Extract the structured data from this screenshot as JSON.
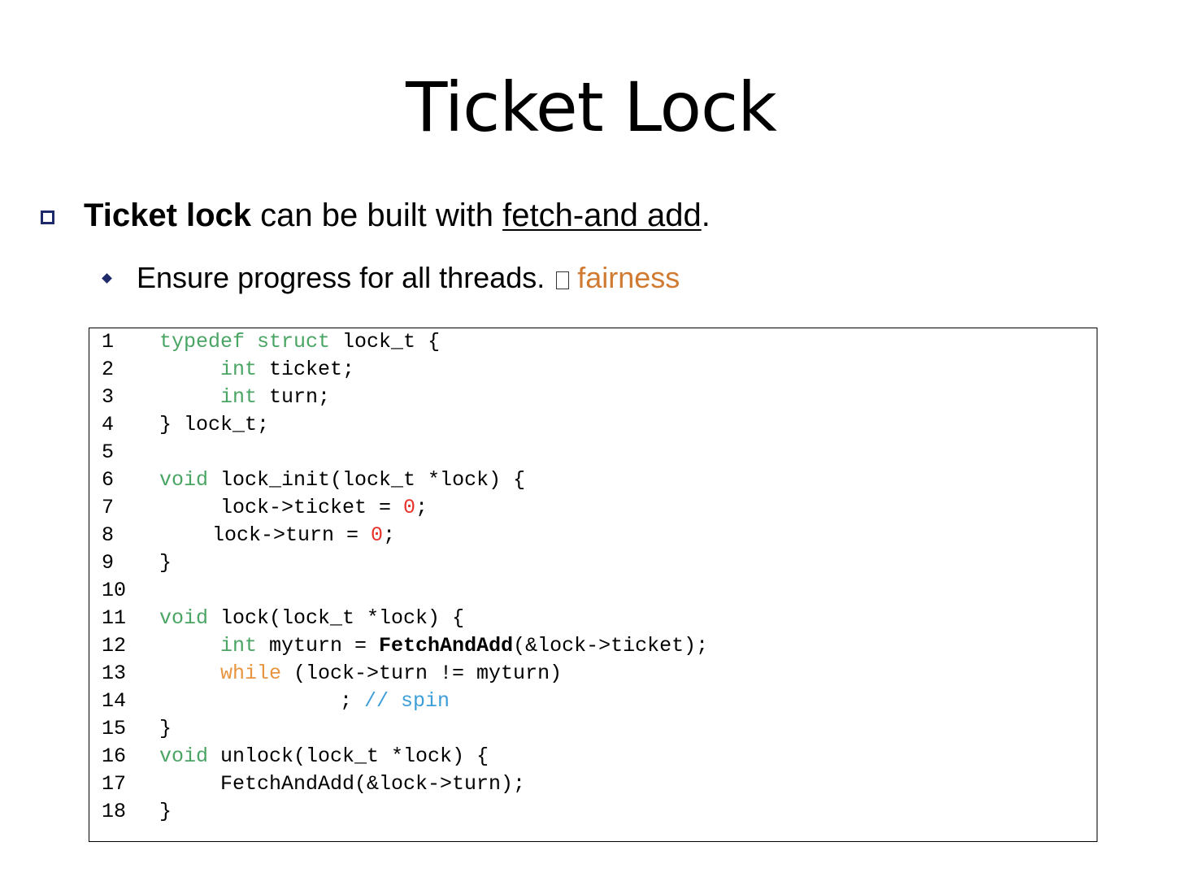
{
  "slide": {
    "title": "Ticket Lock"
  },
  "bullets": {
    "level1": {
      "bold": "Ticket lock",
      "middle": " can be built with ",
      "underlined": "fetch-and add",
      "end": "."
    },
    "level2": {
      "text": "Ensure progress for all threads. ",
      "highlight": "fairness"
    }
  },
  "code": {
    "line_numbers": [
      "1",
      "2",
      "3",
      "4",
      "5",
      "6",
      "7",
      "8",
      "9",
      "10",
      "11",
      "12",
      "13",
      "14",
      "15",
      "16",
      "17",
      "18"
    ],
    "l1": {
      "kw": "typedef struct",
      "rest": " lock_t {"
    },
    "l2": {
      "kw": "int",
      "rest": " ticket;"
    },
    "l3": {
      "kw": "int",
      "rest": " turn;"
    },
    "l4": {
      "rest": "} lock_t;"
    },
    "l6": {
      "kw": "void",
      "rest": " lock_init(lock_t *lock) {"
    },
    "l7": {
      "a": "lock->ticket = ",
      "num": "0",
      "b": ";"
    },
    "l8": {
      "a": "lock->turn = ",
      "num": "0",
      "b": ";"
    },
    "l9": {
      "rest": "}"
    },
    "l11": {
      "kw": "void",
      "rest": " lock(lock_t *lock) {"
    },
    "l12": {
      "kw": "int",
      "a": " myturn = ",
      "bold": "FetchAndAdd",
      "b": "(&lock->ticket);"
    },
    "l13": {
      "kw": "while",
      "rest": " (lock->turn != myturn)"
    },
    "l14": {
      "a": "; ",
      "comment": "// spin"
    },
    "l15": {
      "rest": "}"
    },
    "l16": {
      "kw": "void",
      "rest": " unlock(lock_t *lock) {"
    },
    "l17": {
      "rest": "FetchAndAdd(&lock->turn);"
    },
    "l18": {
      "rest": "}"
    }
  }
}
